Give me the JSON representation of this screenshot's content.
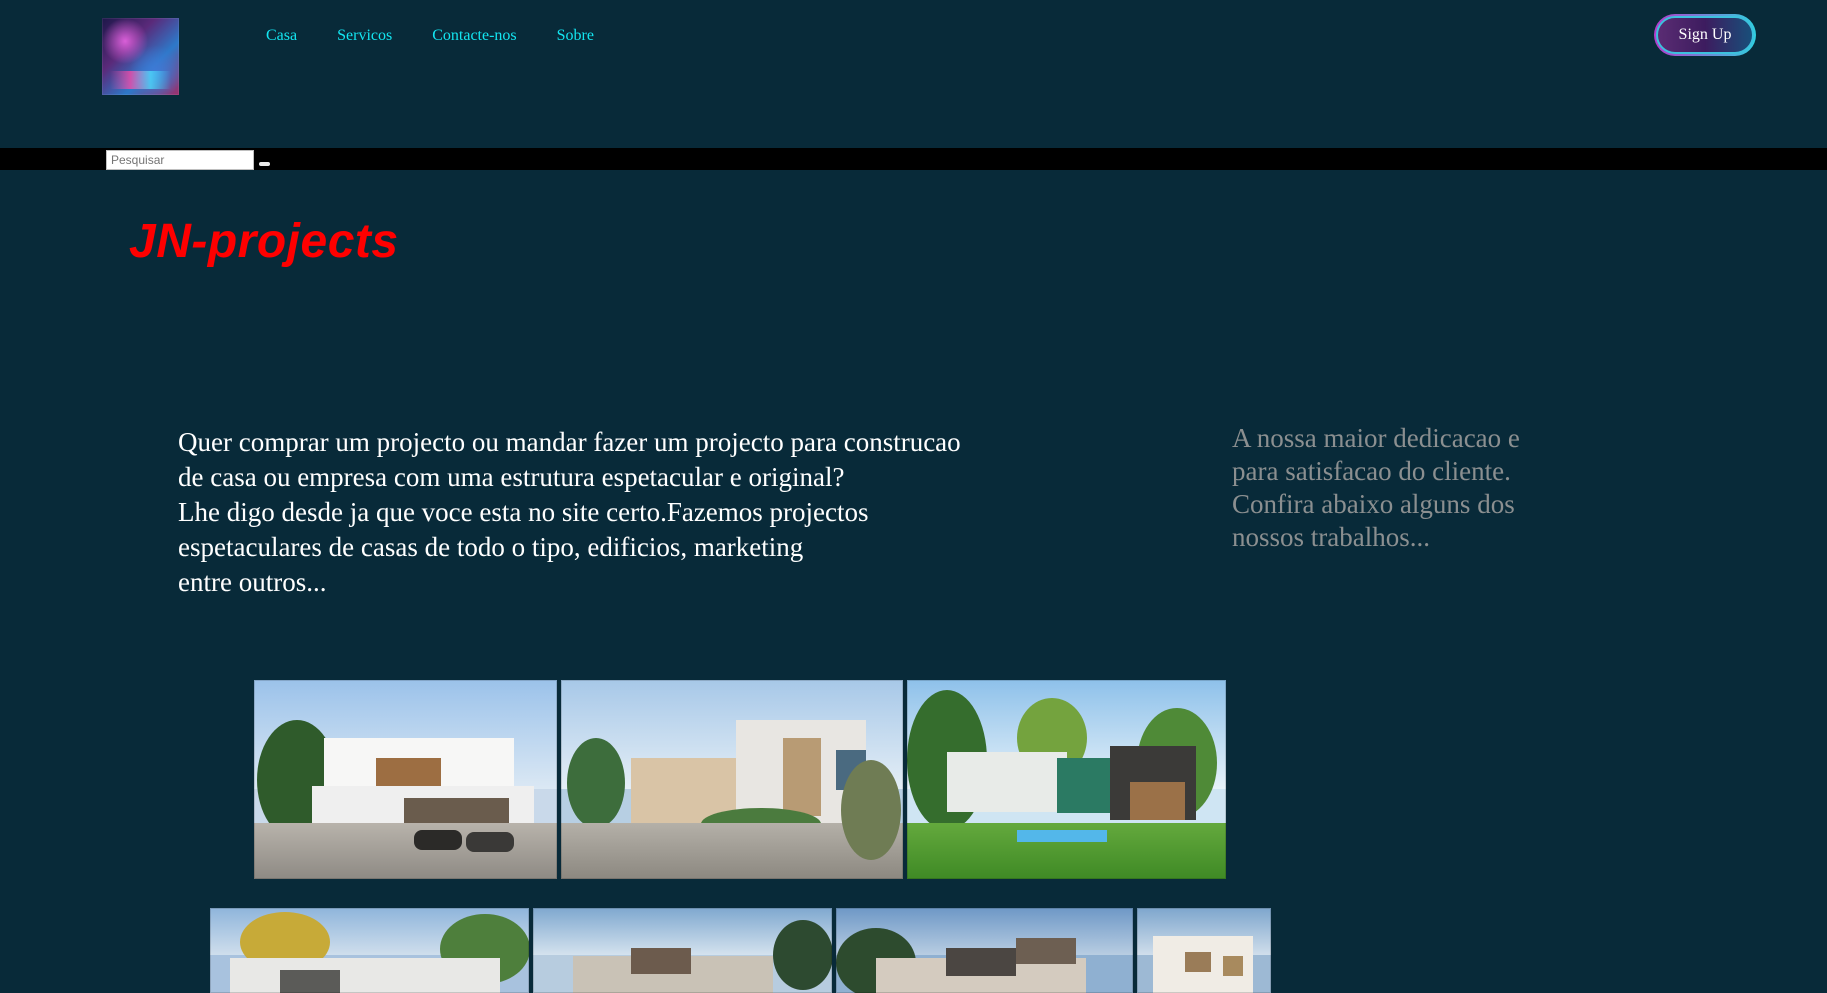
{
  "header": {
    "nav": [
      "Casa",
      "Servicos",
      "Contacte-nos",
      "Sobre"
    ],
    "signup_label": "Sign Up",
    "search": {
      "placeholder": "Pesquisar"
    }
  },
  "main": {
    "brand": "JN-projects",
    "intro_lines": [
      "Quer comprar um projecto ou mandar fazer um projecto para construcao",
      "de casa ou empresa com uma estrutura espetacular e original?",
      "Lhe digo desde ja que voce esta no site certo.Fazemos projectos",
      "espetaculares de casas de todo o tipo, edificios, marketing",
      "entre outros..."
    ],
    "aside_lines": [
      "A nossa maior dedicacao e",
      "para satisfacao do cliente.",
      "Confira abaixo alguns dos",
      "nossos trabalhos..."
    ]
  },
  "gallery": {
    "row1": [
      "modern-house-1",
      "modern-house-2",
      "modern-house-3"
    ],
    "row2": [
      "modern-house-4",
      "modern-house-5",
      "modern-house-6",
      "modern-house-7"
    ]
  }
}
